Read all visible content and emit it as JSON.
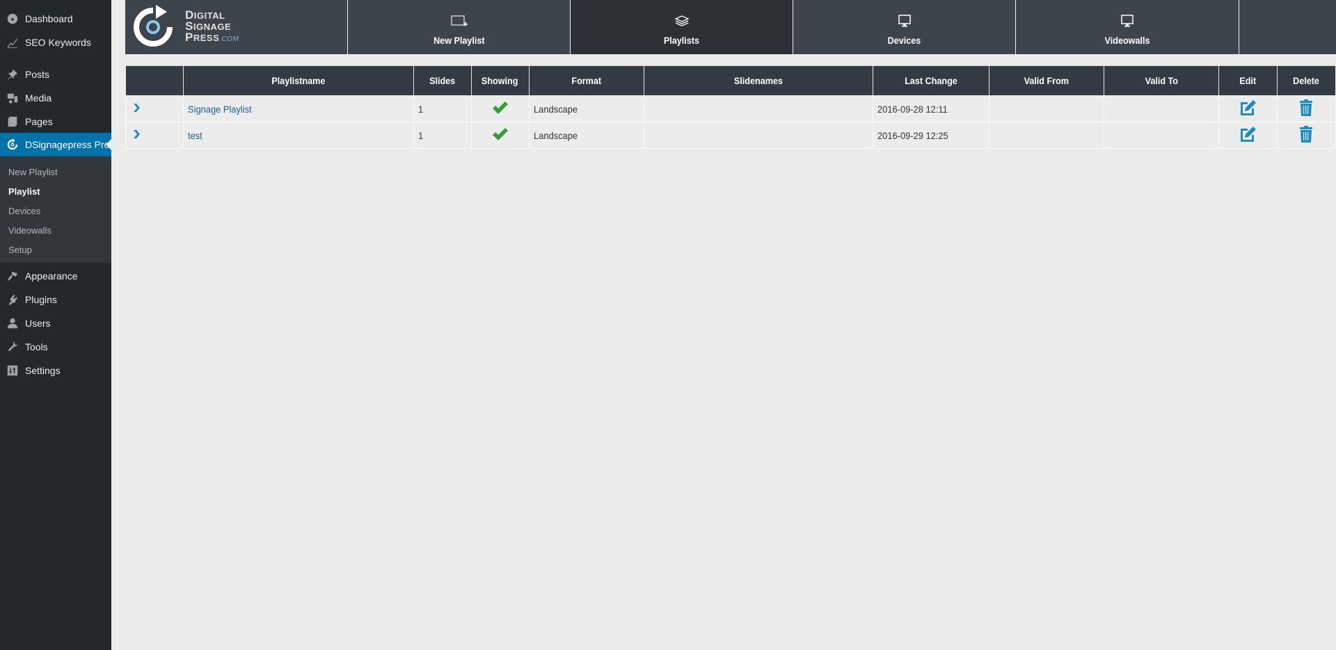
{
  "sidebar": {
    "items": [
      {
        "label": "Dashboard",
        "icon": "dashboard-icon"
      },
      {
        "label": "SEO Keywords",
        "icon": "chart-line-icon"
      },
      {
        "label": "Posts",
        "icon": "pin-icon"
      },
      {
        "label": "Media",
        "icon": "media-icon"
      },
      {
        "label": "Pages",
        "icon": "pages-icon"
      },
      {
        "label": "DSignagepress Pro",
        "icon": "dsp-refresh-icon",
        "active": true
      },
      {
        "label": "Appearance",
        "icon": "paintbrush-icon"
      },
      {
        "label": "Plugins",
        "icon": "plugin-icon"
      },
      {
        "label": "Users",
        "icon": "user-icon"
      },
      {
        "label": "Tools",
        "icon": "wrench-icon"
      },
      {
        "label": "Settings",
        "icon": "settings-icon"
      }
    ],
    "submenu": [
      {
        "label": "New Playlist"
      },
      {
        "label": "Playlist",
        "current": true
      },
      {
        "label": "Devices"
      },
      {
        "label": "Videowalls"
      },
      {
        "label": "Setup"
      }
    ]
  },
  "logo": {
    "line1_first": "D",
    "line1_rest": "IGITAL",
    "line2_first": "S",
    "line2_rest": "IGNAGE",
    "line3_first": "P",
    "line3_rest": "RESS",
    "suffix": ".COM"
  },
  "topnav": {
    "items": [
      {
        "label": "New Playlist",
        "icon": "new-playlist-icon"
      },
      {
        "label": "Playlists",
        "icon": "layers-icon",
        "active": true
      },
      {
        "label": "Devices",
        "icon": "monitor-icon"
      },
      {
        "label": "Videowalls",
        "icon": "monitor-icon"
      }
    ]
  },
  "table": {
    "columns": [
      "",
      "Playlistname",
      "Slides",
      "Showing",
      "Format",
      "Slidenames",
      "Last Change",
      "Valid From",
      "Valid To",
      "Edit",
      "Delete"
    ],
    "rows": [
      {
        "name": "Signage Playlist",
        "slides": "1",
        "showing": true,
        "format": "Landscape",
        "slidenames": "",
        "last_change": "2016-09-28 12:11",
        "valid_from": "",
        "valid_to": ""
      },
      {
        "name": "test",
        "slides": "1",
        "showing": true,
        "format": "Landscape",
        "slidenames": "",
        "last_change": "2016-09-29 12:25",
        "valid_from": "",
        "valid_to": ""
      }
    ]
  },
  "colors": {
    "accent": "#0073aa",
    "icon_blue": "#1e8cbe",
    "check_green": "#3a9b3a",
    "header_bg": "#323a44",
    "nav_bg": "#3e444c",
    "sidebar_bg": "#23282d"
  }
}
